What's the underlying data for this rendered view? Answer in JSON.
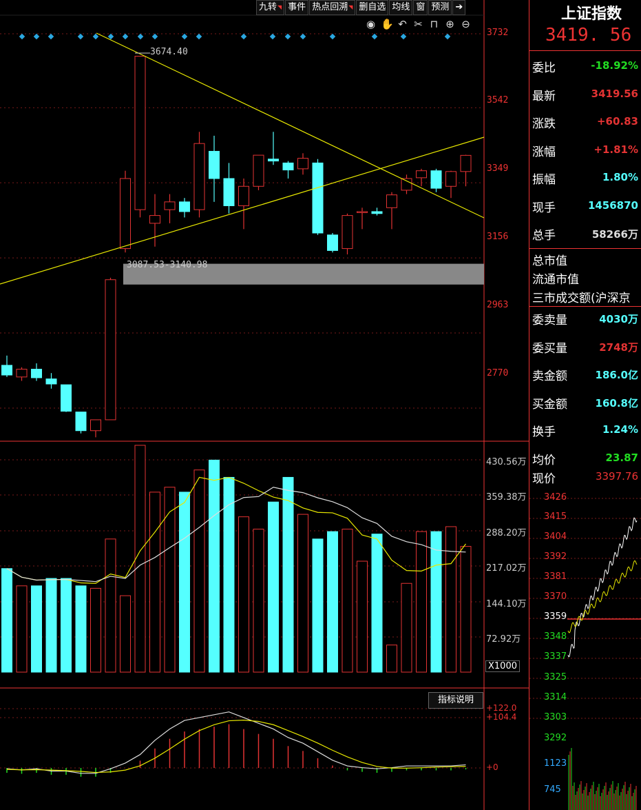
{
  "toolbar": {
    "buttons": [
      "九转",
      "事件",
      "热点回溯",
      "删自选",
      "均线",
      "窗",
      "预测"
    ],
    "arrow_icon": "export-arrow-icon"
  },
  "chart_icons": [
    "eye-icon",
    "hand-icon",
    "undo-icon",
    "scissors-icon",
    "lock-icon",
    "zoom-in-icon",
    "zoom-out-icon"
  ],
  "price_axis": [
    "3732",
    "3542",
    "3349",
    "3156",
    "2963",
    "2770"
  ],
  "annotations": {
    "high": "3674.40",
    "zone": "3087.53-3140.98"
  },
  "volume_axis": [
    "430.56万",
    "359.38万",
    "288.20万",
    "217.02万",
    "144.10万",
    "72.92万"
  ],
  "volume_unit": "X1000",
  "indicator_button": "指标说明",
  "macd_axis": [
    "+122.0",
    "+104.4",
    "+0"
  ],
  "colors": {
    "up": "#e33333",
    "down": "#55ffff",
    "ma_yellow": "#e8e800",
    "ma_white": "#dddddd"
  },
  "chart_data": {
    "type": "candlestick",
    "candles": [
      {
        "o": 2880,
        "h": 2905,
        "l": 2850,
        "c": 2855
      },
      {
        "o": 2850,
        "h": 2875,
        "l": 2840,
        "c": 2870
      },
      {
        "o": 2870,
        "h": 2885,
        "l": 2840,
        "c": 2848
      },
      {
        "o": 2845,
        "h": 2860,
        "l": 2820,
        "c": 2832
      },
      {
        "o": 2830,
        "h": 2830,
        "l": 2760,
        "c": 2762
      },
      {
        "o": 2760,
        "h": 2760,
        "l": 2705,
        "c": 2712
      },
      {
        "o": 2712,
        "h": 2735,
        "l": 2695,
        "c": 2740
      },
      {
        "o": 2740,
        "h": 3105,
        "l": 2740,
        "c": 3100
      },
      {
        "o": 3180,
        "h": 3380,
        "l": 3170,
        "c": 3360
      },
      {
        "o": 3280,
        "h": 3674.4,
        "l": 3260,
        "c": 3674.4
      },
      {
        "o": 3245,
        "h": 3320,
        "l": 3185,
        "c": 3265
      },
      {
        "o": 3280,
        "h": 3320,
        "l": 3245,
        "c": 3300
      },
      {
        "o": 3300,
        "h": 3310,
        "l": 3260,
        "c": 3275
      },
      {
        "o": 3280,
        "h": 3480,
        "l": 3260,
        "c": 3450
      },
      {
        "o": 3430,
        "h": 3470,
        "l": 3300,
        "c": 3360
      },
      {
        "o": 3360,
        "h": 3400,
        "l": 3270,
        "c": 3290
      },
      {
        "o": 3290,
        "h": 3360,
        "l": 3230,
        "c": 3340
      },
      {
        "o": 3340,
        "h": 3420,
        "l": 3330,
        "c": 3420
      },
      {
        "o": 3410,
        "h": 3480,
        "l": 3395,
        "c": 3405
      },
      {
        "o": 3400,
        "h": 3405,
        "l": 3360,
        "c": 3382
      },
      {
        "o": 3385,
        "h": 3425,
        "l": 3370,
        "c": 3412
      },
      {
        "o": 3400,
        "h": 3410,
        "l": 3215,
        "c": 3220
      },
      {
        "o": 3215,
        "h": 3220,
        "l": 3170,
        "c": 3175
      },
      {
        "o": 3180,
        "h": 3270,
        "l": 3165,
        "c": 3265
      },
      {
        "o": 3275,
        "h": 3285,
        "l": 3230,
        "c": 3275
      },
      {
        "o": 3275,
        "h": 3285,
        "l": 3265,
        "c": 3270
      },
      {
        "o": 3285,
        "h": 3325,
        "l": 3230,
        "c": 3318
      },
      {
        "o": 3330,
        "h": 3370,
        "l": 3320,
        "c": 3360
      },
      {
        "o": 3362,
        "h": 3385,
        "l": 3340,
        "c": 3380
      },
      {
        "o": 3380,
        "h": 3385,
        "l": 3325,
        "c": 3335
      },
      {
        "o": 3340,
        "h": 3380,
        "l": 3310,
        "c": 3378
      },
      {
        "o": 3378,
        "h": 3421,
        "l": 3340,
        "c": 3419.56
      }
    ],
    "volumes": [
      210,
      175,
      175,
      190,
      190,
      175,
      170,
      270,
      155,
      460,
      365,
      375,
      365,
      410,
      430,
      395,
      315,
      290,
      345,
      395,
      320,
      270,
      285,
      290,
      225,
      280,
      55,
      180,
      285,
      285,
      295,
      255
    ],
    "price_range": [
      2680,
      3760
    ],
    "volume_max": 430.56,
    "macd_hist": [
      -10,
      -12,
      -10,
      -14,
      -14,
      -18,
      -18,
      -10,
      0,
      15,
      40,
      60,
      75,
      80,
      85,
      90,
      80,
      70,
      60,
      45,
      35,
      20,
      5,
      -5,
      -8,
      -10,
      -8,
      -5,
      -5,
      -5,
      -5,
      -3
    ],
    "macd_range": [
      -50,
      122
    ]
  },
  "quote": {
    "name": "上证指数",
    "price": "3419. 56",
    "rows": [
      {
        "label": "委比",
        "value": "-18.92%",
        "color": "#22dd22"
      },
      {
        "label": "最新",
        "value": "3419.56",
        "color": "#e33333"
      },
      {
        "label": "涨跌",
        "value": "+60.83",
        "color": "#e33333"
      },
      {
        "label": "涨幅",
        "value": "+1.81%",
        "color": "#e33333"
      },
      {
        "label": "振幅",
        "value": "1.80%",
        "color": "#55ffff"
      },
      {
        "label": "现手",
        "value": "1456870",
        "color": "#55ffff"
      },
      {
        "label": "总手",
        "value": "58266万",
        "color": "#dddddd"
      }
    ],
    "plain_rows": [
      "总市值",
      "流通市值",
      "三市成交额(沪深京"
    ],
    "rows2": [
      {
        "label": "委卖量",
        "value": "4030万",
        "color": "#55ffff"
      },
      {
        "label": "委买量",
        "value": "2748万",
        "color": "#e33333"
      },
      {
        "label": "卖金额",
        "value": "186.0亿",
        "color": "#55ffff"
      },
      {
        "label": "买金额",
        "value": "160.8亿",
        "color": "#55ffff"
      },
      {
        "label": "换手",
        "value": "1.24%",
        "color": "#55ffff"
      },
      {
        "label": "均价",
        "value": "23.87",
        "color": "#22dd22"
      }
    ],
    "current": {
      "label": "现价",
      "value": "3397.76"
    },
    "mini_axis": [
      "3426",
      "3415",
      "3404",
      "3392",
      "3381",
      "3370",
      "3359",
      "3348",
      "3337",
      "3325",
      "3314",
      "3303",
      "3292",
      "1123",
      "745"
    ]
  }
}
